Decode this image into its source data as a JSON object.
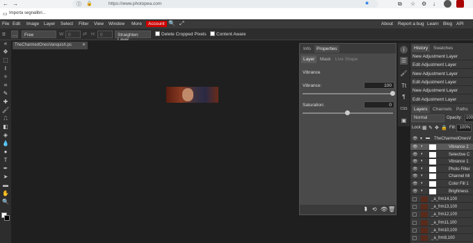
{
  "browser": {
    "url": "https://www.photopea.com",
    "bookmark": "Importa segnalibri..."
  },
  "menu": [
    "File",
    "Edit",
    "Image",
    "Layer",
    "Select",
    "Filter",
    "View",
    "Window",
    "More"
  ],
  "account_label": "Account",
  "menu_right": [
    "About",
    "Report a bug",
    "Learn",
    "Blog",
    "API"
  ],
  "options": {
    "mode": "Free",
    "w_label": "W:",
    "w_value": "0",
    "h_label": "H:",
    "h_value": "0",
    "straighten": "Straighten Layer",
    "delete_cropped": "Delete Cropped Pixels",
    "content_aware": "Content Aware"
  },
  "doc_tab": "TheCharmedOnesVanquish.ps",
  "props": {
    "tabs": [
      "Info",
      "Properties"
    ],
    "subtabs": [
      "Layer",
      "Mask",
      "Live Shape"
    ],
    "heading": "Vibrance",
    "vibrance_label": "Vibrance:",
    "vibrance_value": "100",
    "vibrance_level": 1.0,
    "saturation_label": "Saturation:",
    "saturation_value": "0",
    "saturation_level": 0.5
  },
  "history": {
    "tabs": [
      "History",
      "Swatches"
    ],
    "items": [
      "New Adjustment Layer",
      "Edit Adjustment Layer",
      "New Adjustment Layer",
      "Edit Adjustment Layer",
      "New Adjustment Layer",
      "Edit Adjustment Layer",
      "Edit Adjustment Layer"
    ]
  },
  "layers": {
    "tabs": [
      "Layers",
      "Channels",
      "Paths"
    ],
    "blend": "Normal",
    "opacity_label": "Opacity:",
    "opacity": "100",
    "lock_label": "Lock:",
    "fill_label": "Fill:",
    "fill": "100%",
    "group": "TheCharmedOnesV",
    "adjustments": [
      "Vibrance 2",
      "Selective C",
      "Vibrance 1",
      "Photo Filter",
      "Channel Mi",
      "Color Fill 1",
      "Brightness"
    ],
    "frames": [
      "_a_frm14,100",
      "_a_frm13,100",
      "_a_frm12,100",
      "_a_frm11,100",
      "_a_frm10,100",
      "_a_frm9,100"
    ]
  }
}
